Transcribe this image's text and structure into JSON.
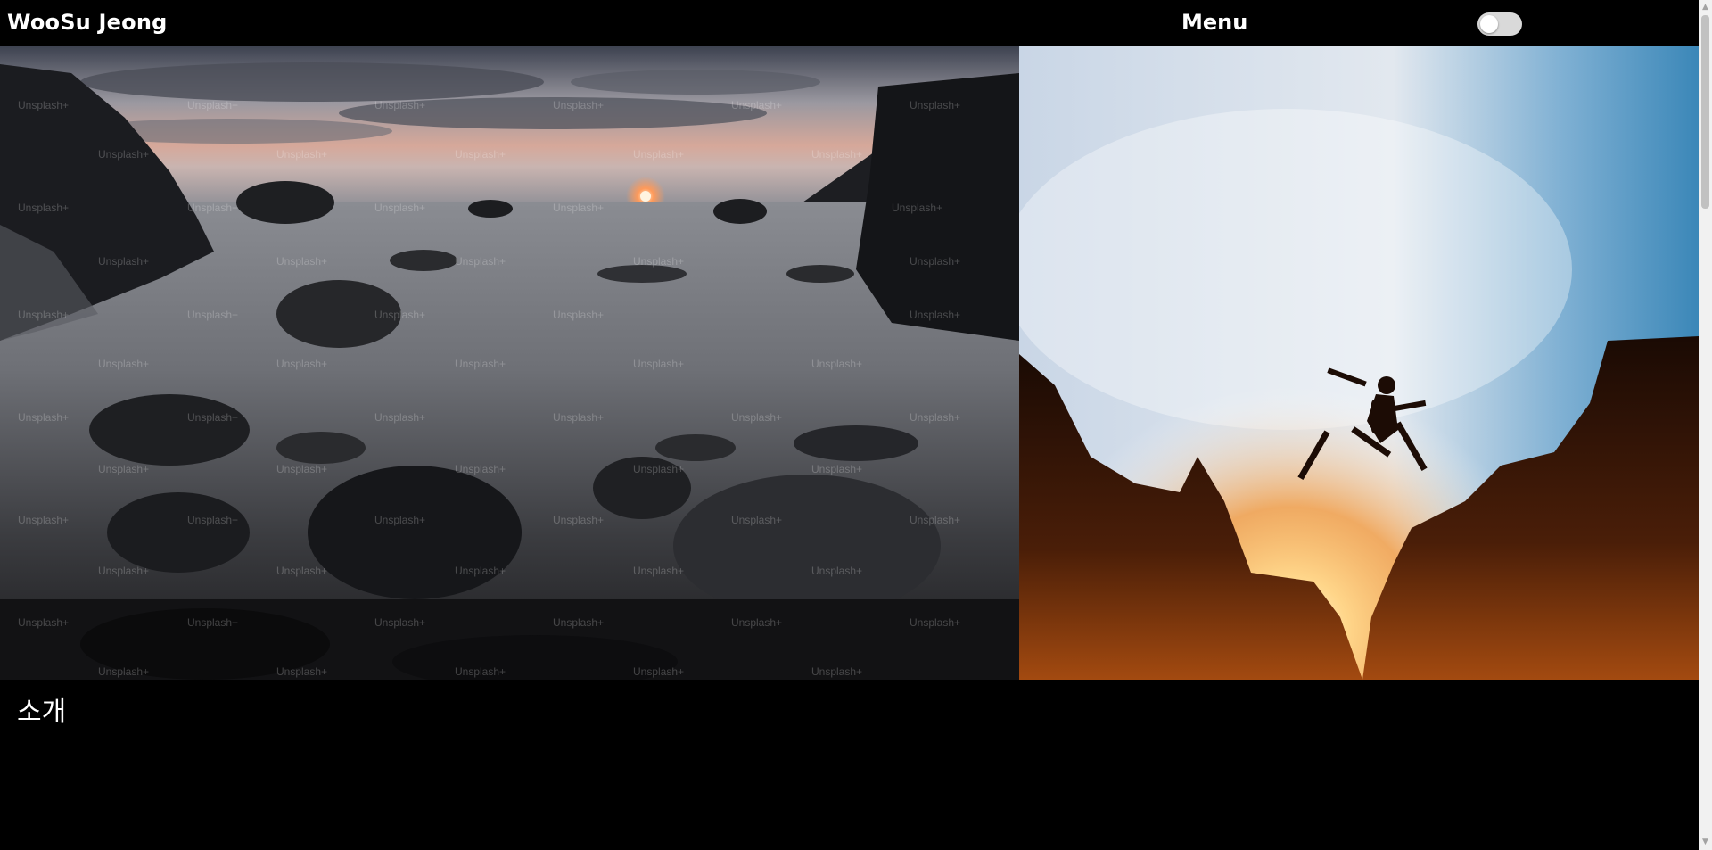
{
  "header": {
    "brand": "WooSu Jeong",
    "menu_label": "Menu",
    "theme_toggle": {
      "state": "off"
    }
  },
  "hero": {
    "left_image": {
      "description_icon": "photo-icon",
      "watermark": "Unsplash+"
    },
    "right_image": {
      "description_icon": "photo-icon"
    }
  },
  "main": {
    "section_title": "소개"
  },
  "colors": {
    "background": "#000000",
    "text": "#ffffff",
    "toggle_track": "#d9d9d9",
    "sunset_orange": "#f28a1c",
    "sky_blue": "#4a90c2"
  },
  "scrollbar": {
    "up_icon": "▲",
    "down_icon": "▼"
  }
}
